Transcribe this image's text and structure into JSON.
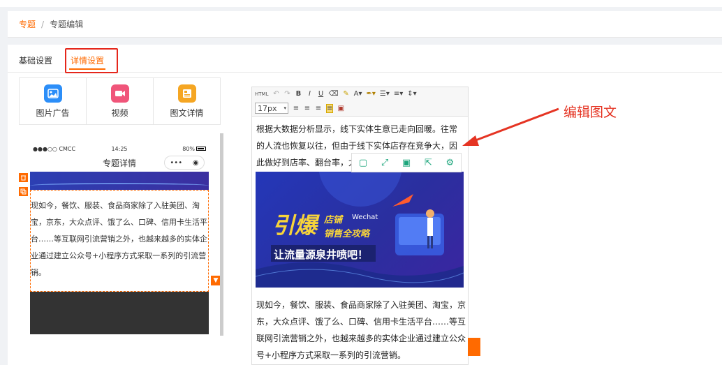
{
  "breadcrumb": {
    "home": "专题",
    "separator": "/",
    "current": "专题编辑"
  },
  "tabs": [
    {
      "label": "基础设置"
    },
    {
      "label": "详情设置"
    }
  ],
  "widgets": [
    {
      "label": "图片广告",
      "icon": "image-icon",
      "color": "#2c8ef8"
    },
    {
      "label": "视频",
      "icon": "video-icon",
      "color": "#f0557a"
    },
    {
      "label": "图文详情",
      "icon": "article-icon",
      "color": "#f5a623"
    }
  ],
  "phone": {
    "carrier": "●●●○○ CMCC",
    "time": "14:25",
    "battery": "80%",
    "title": "专题详情",
    "capsule_more": "•••",
    "text": "现如今，餐饮、服装、食品商家除了入驻美团、淘宝，京东，大众点评、饿了么、口碑、信用卡生活平台……等互联网引流营销之外，也越来越多的实体企业通过建立公众号+小程序方式采取一系列的引流营销。"
  },
  "editor": {
    "font_size": "17px",
    "text1": "根据大数据分析显示，线下实体生意已走向回暖。往常的人流也恢复以往，但由于线下实体店存在竞争大，因此做好到店率、翻台率，尤其关",
    "banner": {
      "main": "引爆",
      "sub1": "店铺",
      "sub2": "Wechat",
      "sub3": "销售全攻略",
      "slogan": "让流量源泉井喷吧！"
    },
    "text2": "现如今，餐饮、服装、食品商家除了入驻美团、淘宝，京东，大众点评、饿了么、口碑、信用卡生活平台……等互联网引流营销之外，也越来越多的实体企业通过建立公众号+小程序方式采取一系列的引流营销。"
  },
  "annotation": "编辑图文"
}
